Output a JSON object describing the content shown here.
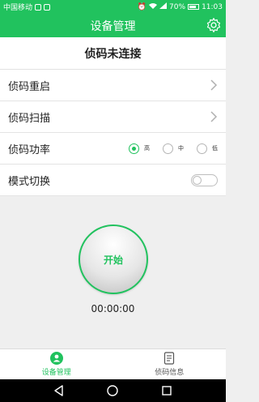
{
  "status_bar": {
    "carrier": "中国移动",
    "battery": "70%",
    "time": "11:03",
    "icons": [
      "notification-icon",
      "alarm-icon",
      "wifi-icon",
      "signal-icon",
      "battery-icon"
    ]
  },
  "header": {
    "title": "设备管理",
    "settings_icon": "gear-icon"
  },
  "connection": {
    "status": "侦码未连接"
  },
  "menu": {
    "restart_label": "侦码重启",
    "scan_label": "侦码扫描",
    "power_label": "侦码功率",
    "power_options": [
      "高",
      "中",
      "低"
    ],
    "power_selected": "高",
    "mode_label": "模式切换",
    "mode_on": false
  },
  "main": {
    "start_label": "开始",
    "timer": "00:00:00"
  },
  "tabs": [
    {
      "label": "设备管理",
      "icon": "person-icon",
      "active": true
    },
    {
      "label": "侦码信息",
      "icon": "document-icon",
      "active": false
    }
  ],
  "colors": {
    "accent": "#21c25e"
  }
}
